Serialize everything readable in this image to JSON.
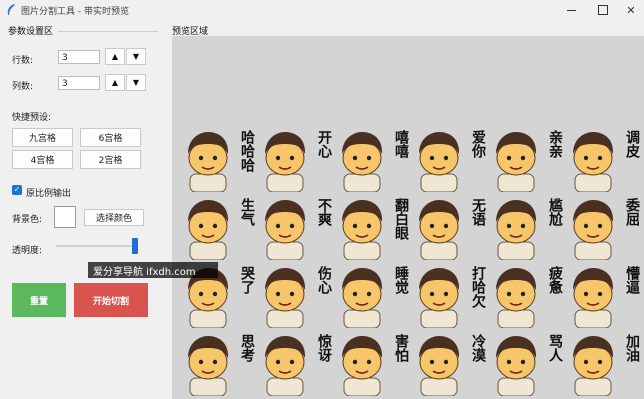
{
  "window": {
    "title": "图片分割工具 - 带实时预览",
    "controls": [
      "minimize",
      "maximize",
      "close"
    ]
  },
  "params": {
    "section_title": "参数设置区",
    "rows_label": "行数:",
    "rows_value": "3",
    "cols_label": "列数:",
    "cols_value": "3",
    "up_arrow": "▲",
    "down_arrow": "▼"
  },
  "presets": {
    "title": "快捷预设:",
    "items": [
      "九宫格",
      "6宫格",
      "4宫格",
      "2宫格"
    ]
  },
  "options": {
    "keep_ratio_label": "原比例输出",
    "keep_ratio_checked": true,
    "bg_label": "背景色:",
    "bg_color": "#ffffff",
    "pick_color_label": "选择颜色",
    "opacity_label": "透明度:",
    "opacity_value": 1.0
  },
  "actions": {
    "reset_label": "重置",
    "start_label": "开始切割",
    "reset_color": "#5cb85c",
    "start_color": "#d9534f"
  },
  "preview": {
    "section_title": "预览区域",
    "cells": [
      {
        "text": "哈哈哈",
        "icon": "laughing-face"
      },
      {
        "text": "开心",
        "icon": "happy-face"
      },
      {
        "text": "嘻嘻",
        "icon": "giggle-face"
      },
      {
        "text": "爱你",
        "icon": "heart-eyes-face"
      },
      {
        "text": "亲亲",
        "icon": "kiss-face"
      },
      {
        "text": "调皮",
        "icon": "cheeky-face"
      },
      {
        "text": "生气",
        "icon": "angry-face"
      },
      {
        "text": "不爽",
        "icon": "annoyed-face"
      },
      {
        "text": "翻白眼",
        "icon": "eye-roll-face"
      },
      {
        "text": "无语",
        "icon": "speechless-face"
      },
      {
        "text": "尴尬",
        "icon": "awkward-face"
      },
      {
        "text": "委屈",
        "icon": "wronged-face"
      },
      {
        "text": "哭了",
        "icon": "crying-face"
      },
      {
        "text": "伤心",
        "icon": "sad-face"
      },
      {
        "text": "睡觉",
        "icon": "sleeping-face"
      },
      {
        "text": "打哈欠",
        "icon": "yawning-face"
      },
      {
        "text": "疲惫",
        "icon": "tired-face"
      },
      {
        "text": "懵逼",
        "icon": "dizzy-face"
      },
      {
        "text": "思考",
        "icon": "thinking-face"
      },
      {
        "text": "惊讶",
        "icon": "surprised-face"
      },
      {
        "text": "害怕",
        "icon": "scared-face"
      },
      {
        "text": "冷漠",
        "icon": "indifferent-face"
      },
      {
        "text": "骂人",
        "icon": "cursing-face"
      },
      {
        "text": "加油",
        "icon": "cheering-face"
      }
    ]
  },
  "watermark": {
    "text": "爱分享导航 ifxdh.com"
  }
}
